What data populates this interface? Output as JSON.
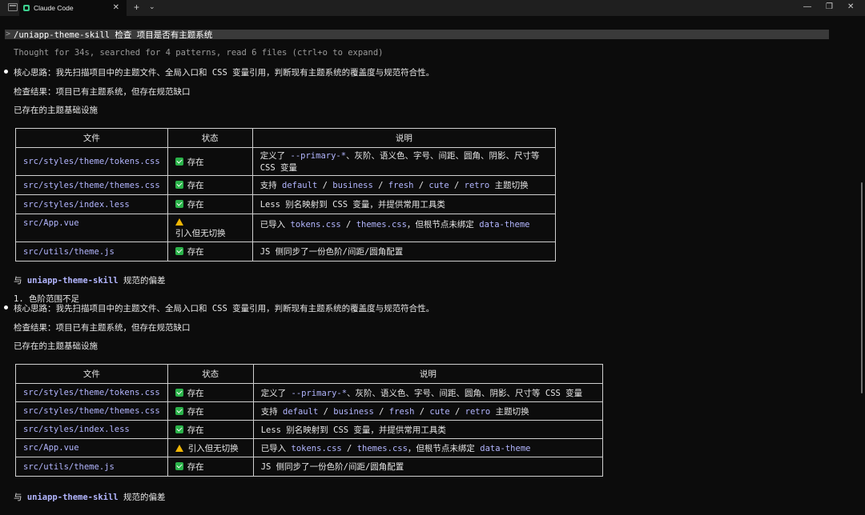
{
  "window": {
    "tab_title": "Claude Code",
    "close_glyph": "✕",
    "new_tab_glyph": "+",
    "dropdown_glyph": "⌄",
    "minimize_glyph": "—",
    "restore_glyph": "❐",
    "window_close_glyph": "✕"
  },
  "command": {
    "caret": ">",
    "text": "/uniapp-theme-skill 检查 项目是否有主题系统"
  },
  "thought": "Thought for 34s, searched for 4 patterns, read 6 files (ctrl+o to expand)",
  "block1": {
    "core_prefix": "核心思路：我先扫描项目中的主题文件、全局入口和 CSS 变量引用，判断现有主题系统的覆盖度与规范符合性。",
    "result": "检查结果：项目已有主题系统，但存在规范缺口",
    "infra": "已存在的主题基础设施"
  },
  "table": {
    "headers": [
      "文件",
      "状态",
      "说明"
    ],
    "rows": [
      {
        "file": "src/styles/theme/tokens.css",
        "status": "存在",
        "desc_a": "定义了 ",
        "code_a": "--primary-*",
        "desc_b": "、灰阶、语义色、字号、间距、圆角、阴影、尺寸等",
        "desc_c": "CSS 变量"
      },
      {
        "file": "src/styles/theme/themes.css",
        "status": "存在",
        "desc_a": "支持 ",
        "code_a": "default",
        "sep1": " / ",
        "code_b": "business",
        "sep2": " / ",
        "code_c": "fresh",
        "sep3": " / ",
        "code_d": "cute",
        "sep4": " / ",
        "code_e": "retro",
        "desc_b": " 主题切换"
      },
      {
        "file": "src/styles/index.less",
        "status": "存在",
        "desc_a": "Less 别名映射到 CSS 变量，并提供常用工具类"
      },
      {
        "file": "src/App.vue",
        "status": "引入但无切换",
        "desc_a": "已导入 ",
        "code_a": "tokens.css",
        "sep1": " / ",
        "code_b": "themes.css",
        "desc_b": "，但根节点未绑定 ",
        "code_c": "data-theme"
      },
      {
        "file": "src/utils/theme.js",
        "status": "存在",
        "desc_a": "JS 侧同步了一份色阶/间距/圆角配置"
      }
    ]
  },
  "deviation": {
    "prefix": "与 ",
    "skill": "uniapp-theme-skill",
    "suffix": " 规范的偏差"
  },
  "list_item": "1. 色阶范围不足"
}
